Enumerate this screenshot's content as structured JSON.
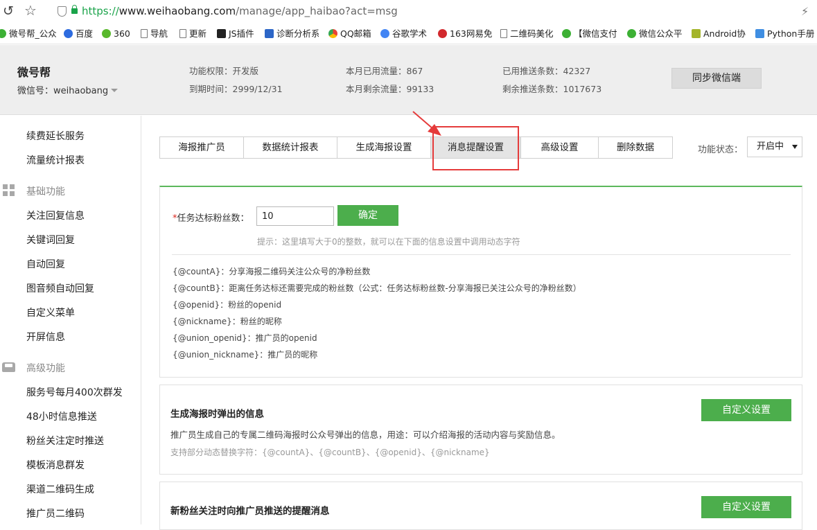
{
  "browser": {
    "url_scheme": "https://",
    "url_host": "www.weihaobang.com",
    "url_path": "/manage/app_haibao?act=msg"
  },
  "bookmarks": [
    {
      "label": "微号帮_公众",
      "icon": "wechat-green-icon",
      "color": "#3cb034"
    },
    {
      "label": "百度",
      "icon": "baidu-paw-icon",
      "color": "#2d6bdf"
    },
    {
      "label": "360",
      "icon": "360-icon",
      "color": "#58b82b"
    },
    {
      "label": "导航",
      "icon": "page-icon",
      "color": "#ffffff"
    },
    {
      "label": "更新",
      "icon": "page-icon",
      "color": "#ffffff"
    },
    {
      "label": "JS插件",
      "icon": "js-icon",
      "color": "#222222"
    },
    {
      "label": "诊断分析系",
      "icon": "chart-icon",
      "color": "#2c66c7"
    },
    {
      "label": "QQ邮箱",
      "icon": "chrome-icon",
      "color": "#e8a90c"
    },
    {
      "label": "谷歌学术",
      "icon": "google-icon",
      "color": "#4285f4"
    },
    {
      "label": "163网易免",
      "icon": "netease-icon",
      "color": "#d2292d"
    },
    {
      "label": "二维码美化",
      "icon": "page-icon",
      "color": "#ffffff"
    },
    {
      "label": "【微信支付",
      "icon": "wechat-icon",
      "color": "#3cb034"
    },
    {
      "label": "微信公众平",
      "icon": "wechat-icon",
      "color": "#3cb034"
    },
    {
      "label": "Android协",
      "icon": "android-icon",
      "color": "#a4b52a"
    },
    {
      "label": "Python手册",
      "icon": "python-icon",
      "color": "#3f8ee2"
    }
  ],
  "header": {
    "account_name": "微号帮",
    "wechat_id": "微信号：weihaobang",
    "permission": "功能权限：开发版",
    "expire": "到期时间：2999/12/31",
    "flow_used": "本月已用流量：867",
    "flow_left": "本月剩余流量：99133",
    "push_used": "已用推送条数：42327",
    "push_left": "剩余推送条数：1017673",
    "sync_button": "同步微信端"
  },
  "sidebar": {
    "top_items": [
      "续费延长服务",
      "流量统计报表"
    ],
    "basic_group": "基础功能",
    "basic_items": [
      "关注回复信息",
      "关键词回复",
      "自动回复",
      "图音频自动回复",
      "自定义菜单",
      "开屏信息"
    ],
    "advanced_group": "高级功能",
    "advanced_items": [
      "服务号每月400次群发",
      "48小时信息推送",
      "粉丝关注定时推送",
      "模板消息群发",
      "渠道二维码生成",
      "推广员二维码"
    ]
  },
  "tabs": [
    {
      "label": "海报推广员",
      "active": false
    },
    {
      "label": "数据统计报表",
      "active": false
    },
    {
      "label": "生成海报设置",
      "active": false
    },
    {
      "label": "消息提醒设置",
      "active": true
    },
    {
      "label": "高级设置",
      "active": false
    },
    {
      "label": "删除数据",
      "active": false
    }
  ],
  "status": {
    "label": "功能状态：",
    "value": "开启中"
  },
  "task": {
    "required_mark": "*",
    "label": "任务达标粉丝数：",
    "value": "10",
    "confirm": "确定",
    "hint": "提示：这里填写大于0的整数，就可以在下面的信息设置中调用动态字符"
  },
  "variables": [
    "{@countA}：分享海报二维码关注公众号的净粉丝数",
    "{@countB}：距离任务达标还需要完成的粉丝数（公式：任务达标粉丝数-分享海报已关注公众号的净粉丝数）",
    "{@openid}：粉丝的openid",
    "{@nickname}：粉丝的昵称",
    "{@union_openid}：推广员的openid",
    "{@union_nickname}：推广员的昵称"
  ],
  "panels": [
    {
      "title": "生成海报时弹出的信息",
      "desc": "推广员生成自己的专属二维码海报时公众号弹出的信息，用途：可以介绍海报的活动内容与奖励信息。",
      "support": "支持部分动态替换字符：{@countA}、{@countB}、{@openid}、{@nickname}",
      "button": "自定义设置"
    },
    {
      "title": "新粉丝关注时向推广员推送的提醒消息",
      "button": "自定义设置"
    }
  ],
  "colors": {
    "accent_green": "#4cae4c",
    "highlight_red": "#e53b3b",
    "header_bg": "#eeeeee"
  }
}
